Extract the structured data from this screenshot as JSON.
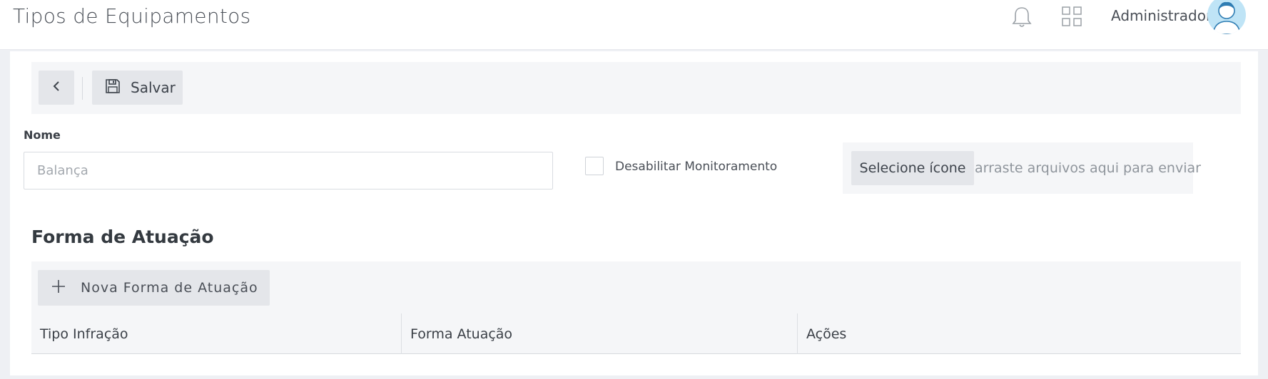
{
  "header": {
    "title": "Tipos de Equipamentos",
    "user_name": "Administrador",
    "icons": [
      "bell-icon",
      "apps-grid-icon",
      "avatar"
    ]
  },
  "toolbar": {
    "back_icon": "chevron-left-icon",
    "save_label": "Salvar",
    "save_icon": "floppy-disk-icon"
  },
  "form": {
    "nome_label": "Nome",
    "nome_placeholder": "Balança",
    "disable_monitoring_label": "Desabilitar Monitoramento",
    "disable_monitoring_checked": false,
    "icon_button_label": "Selecione ícone",
    "drop_hint": "arraste arquivos aqui para enviar"
  },
  "section": {
    "title": "Forma de Atuação",
    "new_button_label": "Nova Forma de Atuação",
    "new_button_icon": "plus-icon",
    "table": {
      "columns": [
        "Tipo Infração",
        "Forma Atuação",
        "Ações"
      ],
      "rows": []
    }
  },
  "colors": {
    "page_bg": "#eef0f4",
    "toolbar_bg": "#f5f6f8",
    "button_bg": "#e4e6ea",
    "avatar_bg": "#bfe4f6"
  }
}
